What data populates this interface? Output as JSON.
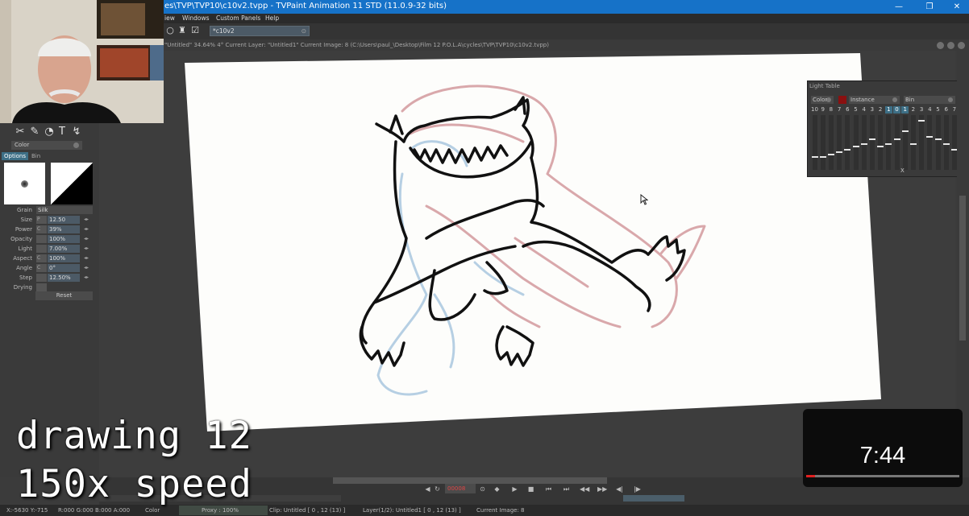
{
  "titlebar": {
    "title": "es\\TVP\\TVP10\\c10v2.tvpp - TVPaint Animation 11 STD (11.0.9-32 bits)",
    "minimize": "—",
    "restore": "❐",
    "close": "✕"
  },
  "menu": {
    "items": [
      "iew",
      "Windows",
      "Custom Panels",
      "Help"
    ]
  },
  "toolbar": {
    "search_value": "*c10v2"
  },
  "docbar": {
    "info": "\"Untitled\"  34.64%  4°  Current Layer: \"Untitled1\"  Current Image: 8 (C:\\Users\\paul_\\Desktop\\Film 12 P.O.L.A\\cycles\\TVP\\TVP10\\c10v2.tvpp)"
  },
  "leftpanel": {
    "color_select": "Color",
    "tabs": [
      "Options",
      "Bin"
    ],
    "grain": {
      "label": "Grain",
      "value": "Silk"
    },
    "params": [
      {
        "label": "Size",
        "mini": "P",
        "value": "12.50"
      },
      {
        "label": "Power",
        "mini": "C",
        "value": "39%"
      },
      {
        "label": "Opacity",
        "mini": "",
        "value": "100%"
      },
      {
        "label": "Light",
        "mini": "",
        "value": "7.00%"
      },
      {
        "label": "Aspect",
        "mini": "C",
        "value": "100%"
      },
      {
        "label": "Angle",
        "mini": "C",
        "value": "0°"
      },
      {
        "label": "Step",
        "mini": "",
        "value": "12.50%"
      },
      {
        "label": "Drying",
        "mini": "",
        "value": ""
      }
    ],
    "reset_label": "Reset"
  },
  "lighttable": {
    "title": "Light Table",
    "color_label": "Color",
    "instance_label": "Instance",
    "bin_label": "Bin",
    "numbers": [
      "10",
      "9",
      "8",
      "7",
      "6",
      "5",
      "4",
      "3",
      "2",
      "1",
      "0",
      "1",
      "2",
      "3",
      "4",
      "5",
      "6",
      "7"
    ],
    "levels": [
      0.2,
      0.2,
      0.25,
      0.3,
      0.35,
      0.4,
      0.45,
      0.55,
      0.4,
      0.45,
      0.55,
      0.7,
      0.45,
      0.9,
      0.6,
      0.55,
      0.45,
      0.35
    ],
    "x_mark": "X",
    "accent": "#1e90e0",
    "swatch": "#8a1010"
  },
  "timeline": {
    "frame": "00008"
  },
  "statusbar": {
    "coords": "X:-5630  Y:-715",
    "rgba": "R:000 G:000 B:000 A:000",
    "color": "Color",
    "proxy": "Proxy : 100%",
    "clip": "Clip: Untitled [ 0 , 12  (13) ]",
    "layer": "Layer(1/2): Untitled1 [ 0 , 12  (13) ]",
    "current_image": "Current Image: 8"
  },
  "overlay": {
    "line1": "drawing 12",
    "line2": "150x speed"
  },
  "timer": {
    "time": "7:44",
    "progress": 0.06
  }
}
